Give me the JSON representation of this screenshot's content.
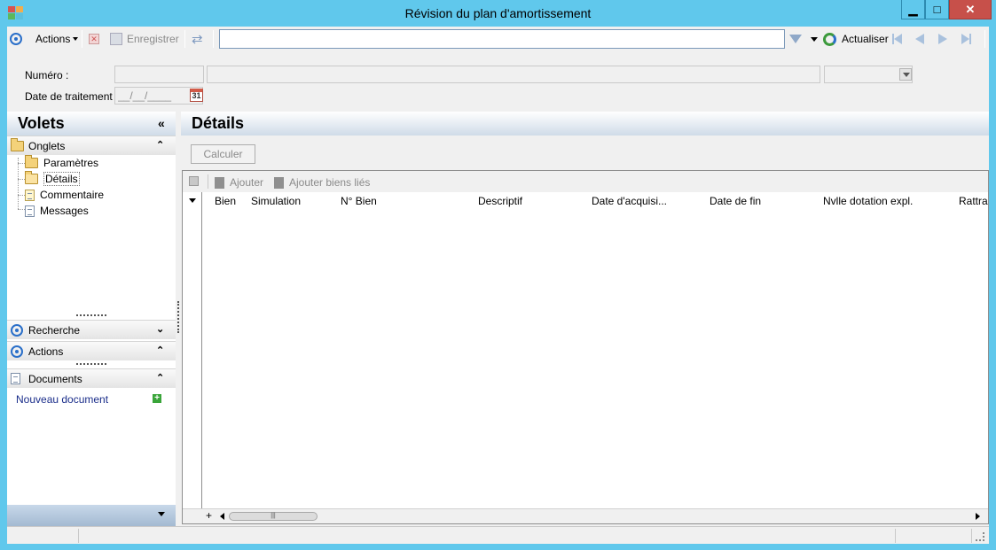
{
  "window": {
    "title": "Révision du plan d'amortissement",
    "min_glyph": "▁",
    "max_glyph": "□",
    "close_glyph": "✕"
  },
  "toolbar": {
    "actions_label": "Actions",
    "save_label": "Enregistrer",
    "search_value": "",
    "refresh_label": "Actualiser"
  },
  "header_fields": {
    "numero_label": "Numéro :",
    "numero_code": "",
    "numero_desc": "",
    "numero_combo": "",
    "date_label": "Date de traitement :",
    "date_value": "__/__/____",
    "calendar_day": "31"
  },
  "left_pane": {
    "title": "Volets",
    "collapse_glyph": "«",
    "onglets_label": "Onglets",
    "tabs": [
      "Paramètres",
      "Détails",
      "Commentaire",
      "Messages"
    ],
    "recherche_label": "Recherche",
    "actions_label": "Actions",
    "documents_label": "Documents",
    "new_document_label": "Nouveau document",
    "new_document_glyph": "+"
  },
  "details": {
    "title": "Détails",
    "calc_label": "Calculer",
    "grid_toolbar": {
      "add_label": "Ajouter",
      "add_linked_label": "Ajouter biens liés"
    },
    "columns": [
      "Bien",
      "Simulation",
      "N° Bien",
      "Descriptif",
      "Date d'acquisi...",
      "Date de fin",
      "Nvlle dotation expl.",
      "Rattra"
    ],
    "add_row_glyph": "+",
    "scroll_thumb_glyph": "|||"
  },
  "colors": {
    "window_frame": "#60c8ec",
    "accent_blue": "#2a6fc9",
    "close_red": "#c7504a",
    "link_blue": "#1a2d8a"
  }
}
